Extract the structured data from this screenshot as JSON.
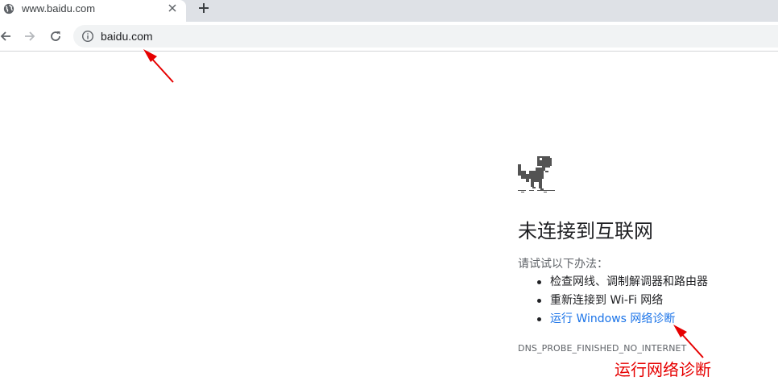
{
  "browser": {
    "tab": {
      "title": "www.baidu.com"
    },
    "omnibox": {
      "url": "baidu.com"
    }
  },
  "error_page": {
    "heading": "未连接到互联网",
    "intro": "请试试以下办法：",
    "suggestions": [
      {
        "text": "检查网线、调制解调器和路由器"
      },
      {
        "text": "重新连接到 Wi-Fi 网络"
      },
      {
        "text": "运行 Windows 网络诊断"
      }
    ],
    "error_code": "DNS_PROBE_FINISHED_NO_INTERNET"
  },
  "annotations": {
    "callout_text": "运行网络诊断",
    "color": "#e60000"
  },
  "colors": {
    "link": "#1a73e8",
    "tabstrip": "#dee1e6",
    "omnibox": "#f1f3f4"
  }
}
